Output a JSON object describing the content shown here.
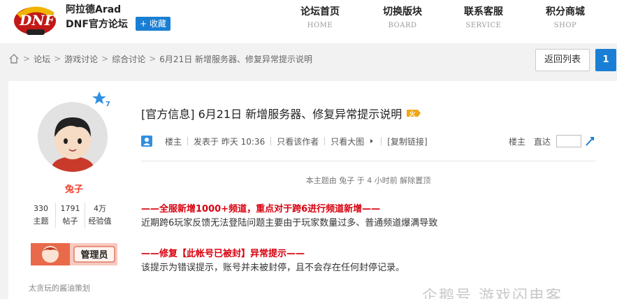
{
  "header": {
    "site_name": "阿拉德Arad",
    "site_subtitle": "DNF官方论坛",
    "fav_button": "+ 收藏",
    "nav": [
      {
        "cn": "论坛首页",
        "en": "HOME"
      },
      {
        "cn": "切换版块",
        "en": "BOARD"
      },
      {
        "cn": "联系客服",
        "en": "SERVICE"
      },
      {
        "cn": "积分商城",
        "en": "SHOP"
      }
    ]
  },
  "breadcrumb": {
    "items": [
      "论坛",
      "游戏讨论",
      "综合讨论",
      "6月21日 新增服务器、修复异常提示说明"
    ],
    "separator": ">"
  },
  "actions": {
    "back_label": "返回列表",
    "page_number": "1"
  },
  "author": {
    "rank_number": "7",
    "username": "兔子",
    "stats": [
      {
        "value": "330",
        "label": "主题"
      },
      {
        "value": "1791",
        "label": "帖子"
      },
      {
        "value": "4万",
        "label": "经验值"
      }
    ],
    "badge_text": "管理员",
    "signature": "太贪玩的酱油策划"
  },
  "post": {
    "title": "[官方信息] 6月21日 新增服务器、修复异常提示说明",
    "hot_label": "火",
    "meta": {
      "role": "楼主",
      "posted": "发表于 昨天 10:36",
      "only_author": "只看该作者",
      "only_images": "只看大图",
      "copy_link": "[复制链接]",
      "floor": "楼主",
      "jump_label": "直达"
    },
    "notice": "本主题由 兔子 于 4 小时前 解除置顶",
    "sections": [
      {
        "heading": "——全服新增1000+频道，重点对于跨6进行频道新增——",
        "text": "近期跨6玩家反馈无法登陆问题主要由于玩家数量过多、普通频道爆满导致"
      },
      {
        "heading": "——修复【此帐号已被封】异常提示——",
        "text": "该提示为错误提示，账号并未被封停，且不会存在任何封停记录。"
      }
    ],
    "watermark": "企鹅号 游戏闪电客"
  },
  "colors": {
    "accent": "#1a7fd4",
    "heading_red": "#d8000f",
    "username_red": "#e43333"
  }
}
